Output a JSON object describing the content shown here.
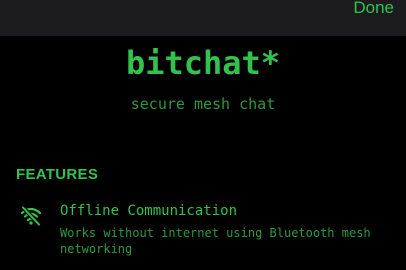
{
  "header": {
    "done_label": "Done"
  },
  "hero": {
    "title": "bitchat*",
    "subtitle": "secure mesh chat"
  },
  "features": {
    "heading": "FEATURES",
    "items": [
      {
        "icon": "wifi-slash-icon",
        "title": "Offline Communication",
        "description": "Works without internet using Bluetooth mesh networking"
      }
    ]
  },
  "colors": {
    "accent": "#33c24d",
    "accent_dim": "#2a9a3e",
    "background": "#000000",
    "topbar": "#1c1c1e"
  }
}
